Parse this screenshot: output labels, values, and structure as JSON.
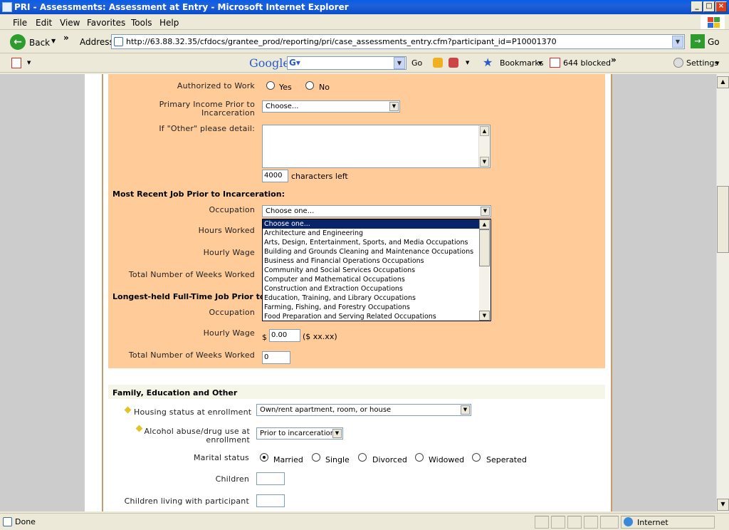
{
  "window": {
    "title": "PRI - Assessments: Assessment at Entry - Microsoft Internet Explorer",
    "min": "_",
    "max": "□",
    "close": "×"
  },
  "menu": [
    "File",
    "Edit",
    "View",
    "Favorites",
    "Tools",
    "Help"
  ],
  "toolbar": {
    "back_label": "Back",
    "address_label": "Address",
    "url": "http://63.88.32.35/cfdocs/grantee_prod/reporting/pri/case_assessments_entry.cfm?participant_id=P10001370",
    "go_label": "Go",
    "chevron": "»"
  },
  "google_toolbar": {
    "brand": "Google",
    "go_label": "Go",
    "bookmarks_label": "Bookmarks",
    "blocked_label": "644 blocked",
    "settings_label": "Settings",
    "chevron": "»"
  },
  "form": {
    "authorized_to_work": {
      "label": "Authorized to Work",
      "options": [
        "Yes",
        "No"
      ],
      "selected": null
    },
    "primary_income": {
      "label_line1": "Primary Income Prior to",
      "label_line2": "Incarceration",
      "value": "Choose..."
    },
    "other_detail": {
      "label": "If \"Other\" please detail:",
      "value": "",
      "chars_left_value": "4000",
      "chars_left_text": "characters left"
    },
    "recent_job": {
      "heading": "Most Recent Job Prior to Incarceration:",
      "occupation_label": "Occupation",
      "occupation_value": "Choose one...",
      "hours_label": "Hours Worked",
      "wage_label": "Hourly Wage",
      "weeks_label": "Total Number of Weeks Worked",
      "dropdown_options": [
        "Choose one...",
        "Architecture and Engineering",
        "Arts, Design, Entertainment, Sports, and Media Occupations",
        "Building and Grounds Cleaning and Maintenance Occupations",
        "Business and Financial Operations Occupations",
        "Community and Social Services Occupations",
        "Computer and Mathematical Occupations",
        "Construction and Extraction Occupations",
        "Education, Training, and Library Occupations",
        "Farming, Fishing, and Forestry Occupations",
        "Food Preparation and Serving Related Occupations"
      ],
      "dropdown_highlighted_index": 0
    },
    "longest_job": {
      "heading": "Longest-held Full-Time Job Prior to In",
      "occupation_label": "Occupation",
      "wage_label": "Hourly Wage",
      "wage_prefix": "$",
      "wage_value": "0.00",
      "wage_format": "($ xx.xx)",
      "weeks_label": "Total Number of Weeks Worked",
      "weeks_value": "0"
    },
    "family": {
      "heading": "Family, Education and Other",
      "housing_label": "Housing status at enrollment",
      "housing_value": "Own/rent apartment, room, or house",
      "alcohol_label_line1": "Alcohol abuse/drug use at",
      "alcohol_label_line2": "enrollment",
      "alcohol_value": "Prior to incarceration",
      "marital_label": "Marital status",
      "marital_options": [
        "Married",
        "Single",
        "Divorced",
        "Widowed",
        "Seperated"
      ],
      "marital_selected": "Married",
      "children_label": "Children",
      "children_living_label": "Children living with participant"
    }
  },
  "status": {
    "text": "Done",
    "zone": "Internet"
  }
}
